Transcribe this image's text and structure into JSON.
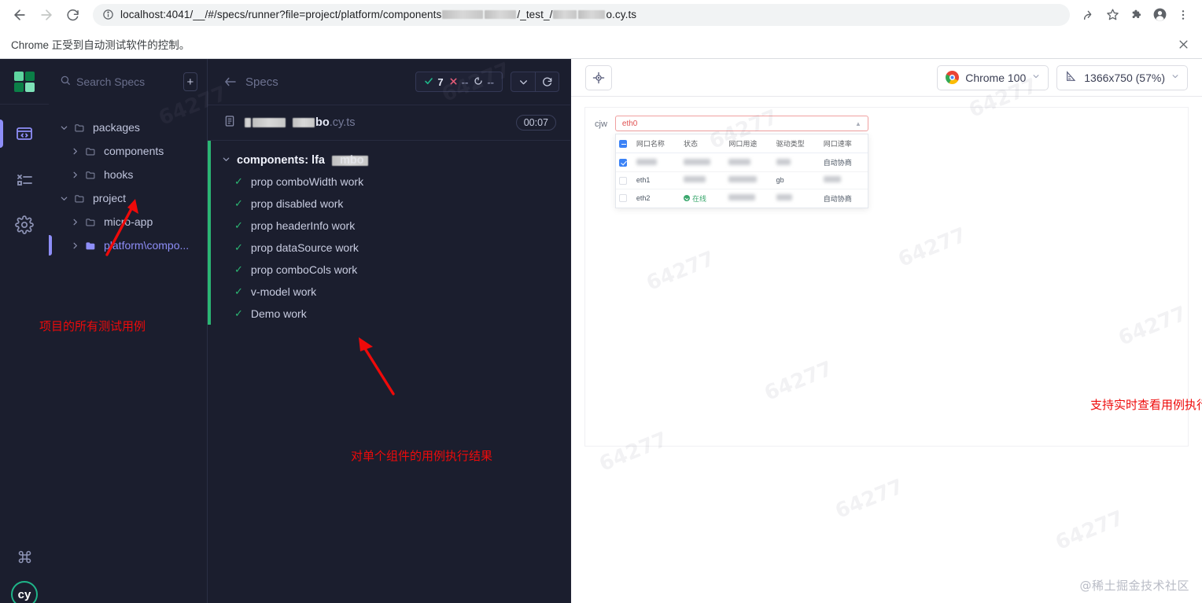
{
  "browser": {
    "back_icon": "arrow-left-icon",
    "forward_icon": "arrow-right-icon",
    "reload_icon": "reload-icon",
    "site_info_icon": "info-circle-icon",
    "url_prefix": "localhost:4041/__/#/specs/runner?file=project/platform/components",
    "url_mid": "/_test_/",
    "url_suffix": "o.cy.ts",
    "share_icon": "share-icon",
    "bookmark_icon": "star-icon",
    "extensions_icon": "puzzle-icon",
    "profile_icon": "profile-avatar-icon",
    "menu_icon": "kebab-menu-icon"
  },
  "infobar": {
    "message": "Chrome 正受到自动测试软件的控制。",
    "close_icon": "close-icon"
  },
  "rail": {
    "logo_name": "cypress-logo",
    "logo_colors": [
      "#5fd6a0",
      "#0b7f47",
      "#0b7f47",
      "#7ee2b8"
    ],
    "items": [
      {
        "name": "specs",
        "icon": "code-window-icon",
        "active": true
      },
      {
        "name": "runs",
        "icon": "test-results-icon",
        "active": false
      },
      {
        "name": "settings",
        "icon": "gear-icon",
        "active": false
      }
    ],
    "bottom": [
      {
        "name": "keyboard-shortcuts",
        "icon": "command-icon"
      },
      {
        "name": "cypress-badge",
        "label": "cy"
      }
    ]
  },
  "sidebar": {
    "search": {
      "placeholder": "Search Specs",
      "value": "",
      "icon": "search-icon"
    },
    "add_button_label": "+",
    "tree": [
      {
        "label": "packages",
        "depth": 0,
        "expanded": true,
        "chevron": "chevron-down-icon",
        "selected": false
      },
      {
        "label": "components",
        "depth": 1,
        "expanded": false,
        "chevron": "chevron-right-icon",
        "selected": false
      },
      {
        "label": "hooks",
        "depth": 1,
        "expanded": false,
        "chevron": "chevron-right-icon",
        "selected": false
      },
      {
        "label": "project",
        "depth": 0,
        "expanded": true,
        "chevron": "chevron-down-icon",
        "selected": false
      },
      {
        "label": "micro-app",
        "depth": 1,
        "expanded": false,
        "chevron": "chevron-right-icon",
        "selected": false
      },
      {
        "label": "platform\\compo...",
        "depth": 1,
        "expanded": false,
        "chevron": "chevron-right-icon",
        "selected": true
      }
    ],
    "annotation": "项目的所有测试用例"
  },
  "reporter": {
    "title": "Specs",
    "collapse_icon": "collapse-left-icon",
    "stats": [
      {
        "name": "passed",
        "icon": "check-icon",
        "value": "7",
        "color": "#1fb589"
      },
      {
        "name": "failed",
        "icon": "cross-icon",
        "value": "--",
        "color": "#e45b78"
      },
      {
        "name": "pending",
        "icon": "circle-dash-icon",
        "value": "--",
        "color": "#c7ccdf"
      }
    ],
    "chevron_button_icon": "chevron-down-icon",
    "restart_button_icon": "restart-icon",
    "spec_file": {
      "icon": "file-icon",
      "name_visible": "bo",
      "extension": ".cy.ts",
      "duration": "00:07"
    },
    "suite": {
      "title_prefix": "components: lfa",
      "title_suffix": "mbo",
      "chevron": "chevron-down-icon"
    },
    "tests": [
      {
        "label": "prop comboWidth work",
        "state": "passed"
      },
      {
        "label": "prop disabled work",
        "state": "passed"
      },
      {
        "label": "prop headerInfo work",
        "state": "passed"
      },
      {
        "label": "prop dataSource work",
        "state": "passed"
      },
      {
        "label": "prop comboCols work",
        "state": "passed"
      },
      {
        "label": "v-model work",
        "state": "passed"
      },
      {
        "label": "Demo work",
        "state": "passed"
      }
    ],
    "annotation": "对单个组件的用例执行结果",
    "accent_color": "#2bb673"
  },
  "aut": {
    "selector_playground_icon": "crosshair-target-icon",
    "browser_pill": {
      "label": "Chrome 100",
      "icon": "chrome-icon",
      "caret": "chevron-down-icon"
    },
    "viewport_pill": {
      "label": "1366x750 (57%)",
      "icon": "ruler-icon",
      "caret": "chevron-down-icon"
    },
    "annotation": "支持实时查看用例执行的快照，查看浏览器控制台",
    "preview": {
      "field_label": "cjw",
      "combo_value": "eth0",
      "combo_caret_icon": "caret-up-icon",
      "columns": [
        "网口名称",
        "状态",
        "网口用途",
        "驱动类型",
        "网口速率"
      ],
      "rows": [
        {
          "checked": true,
          "name": "",
          "status": "",
          "usage": "",
          "driver": "",
          "rate": "自动协商"
        },
        {
          "checked": false,
          "name": "eth1",
          "status": "",
          "usage": "",
          "driver": "gb",
          "rate": ""
        },
        {
          "checked": false,
          "name": "eth2",
          "status": "在线",
          "usage": "",
          "driver": "",
          "rate": "自动协商"
        }
      ],
      "header_checkbox_state": "indeterminate"
    }
  },
  "watermarks": {
    "tile_text": "64277",
    "brand": "@稀土掘金技术社区"
  }
}
